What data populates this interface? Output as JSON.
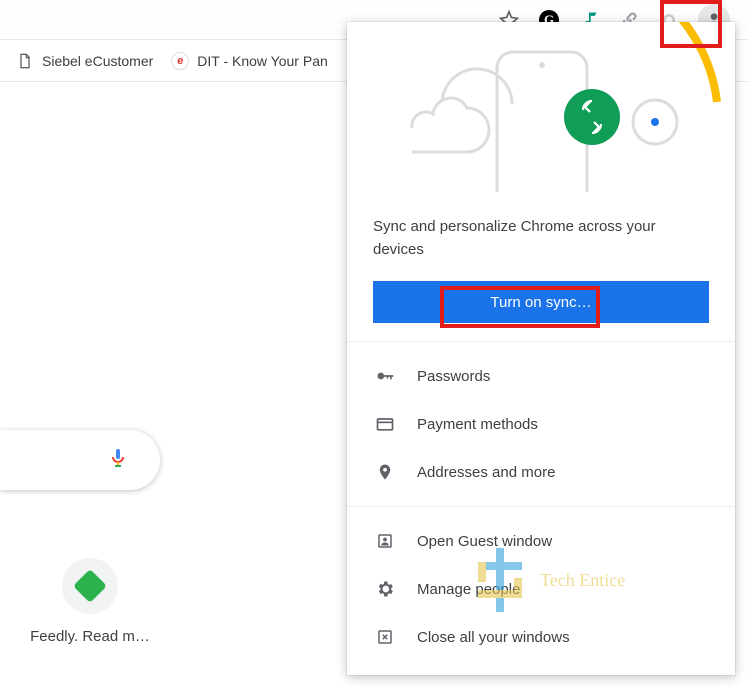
{
  "toolbar": {
    "icons": {
      "star": "star-icon",
      "grammarly": "G",
      "music": "music-icon",
      "link": "link-icon",
      "circle": "circle-icon",
      "profile": "person-icon"
    }
  },
  "bookmarks": {
    "items": [
      {
        "label": "Siebel eCustomer",
        "icon": "file-icon"
      },
      {
        "label": "DIT - Know Your Pan",
        "icon": "dit-icon",
        "icon_text": "e"
      }
    ],
    "overflow": "»"
  },
  "apps_button": "apps-grid-icon",
  "profile_popover": {
    "sync_text": "Sync and personalize Chrome across your devices",
    "sync_button": "Turn on sync…",
    "autofill": [
      {
        "icon": "key-icon",
        "label": "Passwords"
      },
      {
        "icon": "card-icon",
        "label": "Payment methods"
      },
      {
        "icon": "location-icon",
        "label": "Addresses and more"
      }
    ],
    "people": [
      {
        "icon": "guest-icon",
        "label": "Open Guest window"
      },
      {
        "icon": "gear-icon",
        "label": "Manage people"
      },
      {
        "icon": "close-windows-icon",
        "label": "Close all your windows"
      }
    ]
  },
  "ntp": {
    "voice_search": "voice-icon",
    "shortcut": {
      "label": "Feedly. Read m…"
    }
  },
  "watermark": "Tech Entice",
  "highlights": {
    "profile_avatar": true,
    "sync_button": true
  },
  "colors": {
    "accent": "#1a73e8",
    "highlight": "#e21b1b",
    "green": "#0f9d58"
  }
}
